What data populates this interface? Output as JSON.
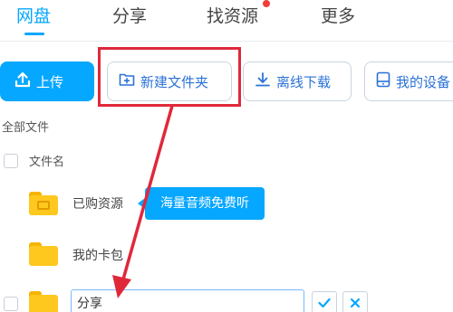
{
  "nav": {
    "tabs": [
      {
        "label": "网盘",
        "active": true
      },
      {
        "label": "分享",
        "active": false
      },
      {
        "label": "找资源",
        "active": false,
        "has_red_dot": true
      },
      {
        "label": "更多",
        "active": false
      }
    ]
  },
  "toolbar": {
    "upload_label": "上传",
    "new_folder_label": "新建文件夹",
    "offline_download_label": "离线下载",
    "my_device_label": "我的设备"
  },
  "file_list": {
    "breadcrumb": "全部文件",
    "column_header": "文件名",
    "rows": [
      {
        "name": "已购资源",
        "icon": "purchased-folder-icon"
      },
      {
        "name": "我的卡包",
        "icon": "folder-icon"
      }
    ],
    "rename_value": "分享"
  },
  "tooltip": {
    "text": "海量音频免费听"
  },
  "colors": {
    "accent": "#06a7ff",
    "highlight": "#e0283b",
    "folder": "#ffc81e"
  }
}
